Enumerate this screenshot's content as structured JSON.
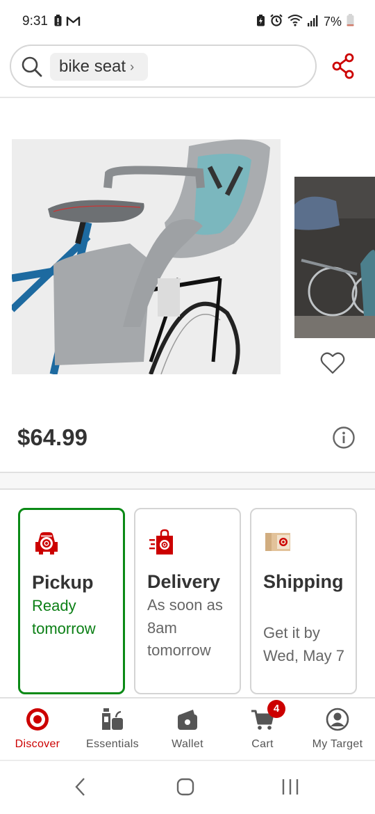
{
  "status_bar": {
    "time": "9:31",
    "battery": "7%",
    "left_icons": [
      "battery-saver-icon",
      "gmail-icon"
    ],
    "right_icons": [
      "data-saver-icon",
      "alarm-icon",
      "wifi-icon",
      "signal-icon",
      "battery-icon"
    ]
  },
  "search": {
    "query": "bike seat",
    "chevron": "›"
  },
  "product": {
    "price": "$64.99",
    "images": [
      "child-bike-seat-photo",
      "bike-trailer-lifestyle-photo"
    ]
  },
  "fulfillment": [
    {
      "title": "Pickup",
      "detail": "Ready tomorrow",
      "selected": true,
      "icon": "pickup-car-icon"
    },
    {
      "title": "Delivery",
      "detail": "As soon as 8am tomorrow",
      "selected": false,
      "icon": "delivery-bag-icon"
    },
    {
      "title": "Shipping",
      "detail": "Get it by Wed, May 7",
      "selected": false,
      "icon": "shipping-box-icon"
    }
  ],
  "bottom_nav": {
    "items": [
      {
        "label": "Discover",
        "icon": "target-logo-icon",
        "active": true
      },
      {
        "label": "Essentials",
        "icon": "essentials-icon",
        "active": false
      },
      {
        "label": "Wallet",
        "icon": "wallet-icon",
        "active": false
      },
      {
        "label": "Cart",
        "icon": "cart-icon",
        "active": false
      },
      {
        "label": "My Target",
        "icon": "profile-icon",
        "active": false
      }
    ],
    "cart_count": "4"
  },
  "colors": {
    "brand_red": "#cc0000",
    "selected_green": "#0b8a16",
    "text_dark": "#333333",
    "text_muted": "#666666"
  }
}
